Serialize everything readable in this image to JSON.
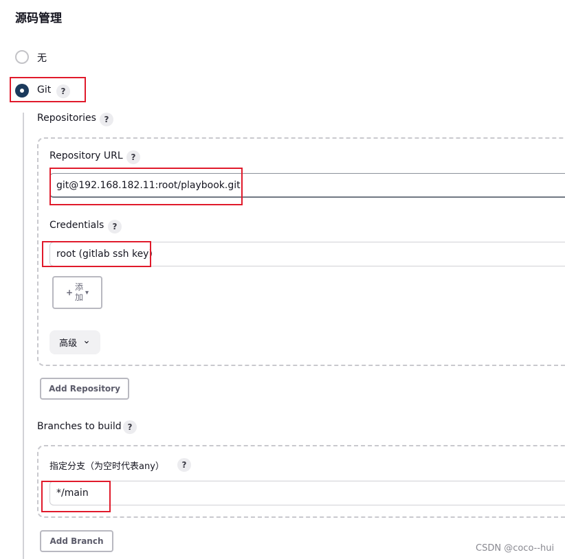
{
  "section": {
    "title": "源码管理"
  },
  "scm_options": [
    {
      "label": "无",
      "selected": false
    },
    {
      "label": "Git",
      "selected": true
    }
  ],
  "help_glyph": "?",
  "repositories": {
    "label": "Repositories",
    "repository_url": {
      "label": "Repository URL",
      "value": "git@192.168.182.11:root/playbook.git"
    },
    "credentials": {
      "label": "Credentials",
      "selected": "root (gitlab ssh key)",
      "add_button": {
        "plus": "+",
        "line1": "添",
        "line2": "加",
        "caret": "▾"
      }
    },
    "advanced": {
      "label": "高级",
      "chevron": "⌄"
    },
    "add_repository_label": "Add Repository"
  },
  "branches": {
    "label": "Branches to build",
    "specifier_label": "指定分支（为空时代表any）",
    "specifier_value": "*/main",
    "add_branch_label": "Add Branch"
  },
  "watermark": "CSDN @coco--hui",
  "colors": {
    "highlight": "#e0192a",
    "radio_selected": "#1b3a5c"
  },
  "icons": {
    "help": "help-icon",
    "chevron": "chevron-down-icon",
    "plus": "plus-icon"
  }
}
